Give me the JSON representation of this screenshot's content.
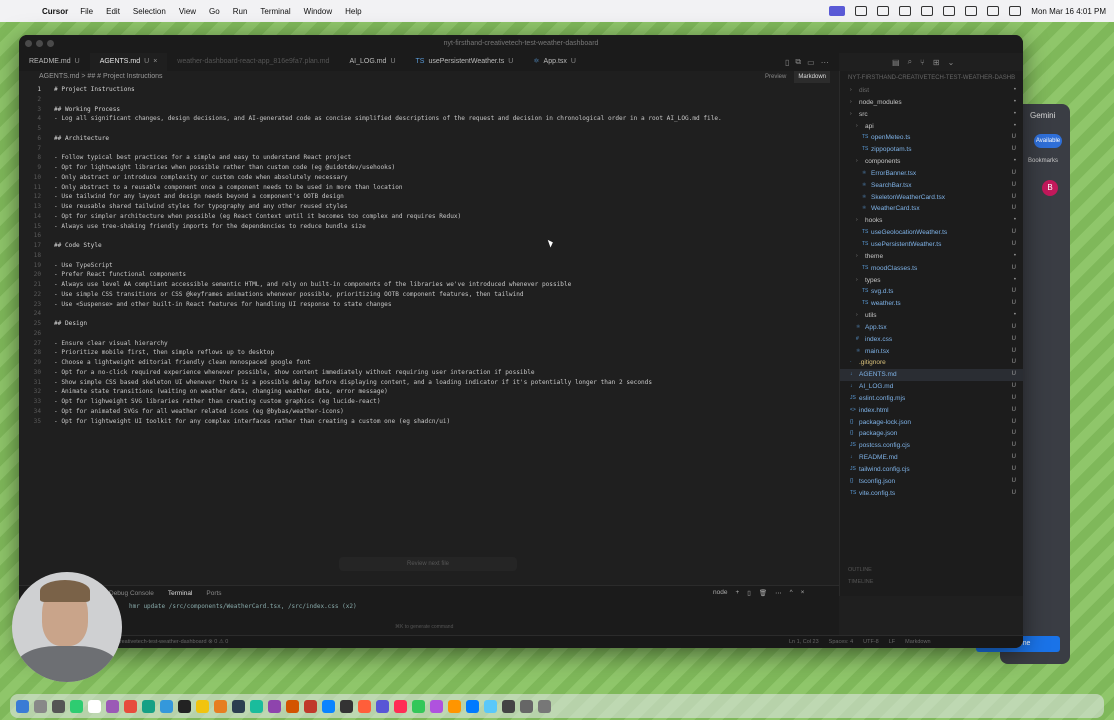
{
  "menubar": {
    "app": "Cursor",
    "items": [
      "File",
      "Edit",
      "Selection",
      "View",
      "Go",
      "Run",
      "Terminal",
      "Window",
      "Help"
    ],
    "clock": "Mon Mar 16  4:01 PM"
  },
  "window": {
    "title": "nyt-firsthand-creativetech-test-weather-dashboard"
  },
  "tabs": [
    {
      "label": "README.md",
      "status": "U",
      "active": false,
      "dim": false
    },
    {
      "label": "AGENTS.md",
      "status": "U",
      "active": true,
      "dim": false,
      "close": "×"
    },
    {
      "label": "weather-dashboard-react-app_816e9fa7.plan.md",
      "status": "",
      "active": false,
      "dim": true
    },
    {
      "label": "AI_LOG.md",
      "status": "U",
      "active": false,
      "dim": false
    },
    {
      "label": "usePersistentWeather.ts",
      "status": "U",
      "active": false,
      "dim": false,
      "icon": "TS"
    },
    {
      "label": "App.tsx",
      "status": "U",
      "active": false,
      "dim": false,
      "icon": "⚛"
    }
  ],
  "breadcrumb": "AGENTS.md > ## # Project Instructions",
  "view_toggle": {
    "preview": "Preview",
    "markdown": "Markdown"
  },
  "editor_lines": [
    {
      "n": "1",
      "t": "# Project Instructions"
    },
    {
      "n": "2",
      "t": ""
    },
    {
      "n": "3",
      "t": "## Working Process"
    },
    {
      "n": "4",
      "t": "- Log all significant changes, design decisions, and AI-generated code as concise simplified descriptions of the request and decision in chronological order in a root AI_LOG.md file."
    },
    {
      "n": "5",
      "t": ""
    },
    {
      "n": "6",
      "t": "## Architecture"
    },
    {
      "n": "7",
      "t": ""
    },
    {
      "n": "8",
      "t": "- Follow typical best practices for a simple and easy to understand React project"
    },
    {
      "n": "9",
      "t": "- Opt for lightweight libraries when possible rather than custom code (eg @uidotdev/usehooks)"
    },
    {
      "n": "10",
      "t": "- Only abstract or introduce complexity or custom code when absolutely necessary"
    },
    {
      "n": "11",
      "t": "- Only abstract to a reusable component once a component needs to be used in more than location"
    },
    {
      "n": "12",
      "t": "- Use tailwind for any layout and design needs beyond a component's OOTB design"
    },
    {
      "n": "13",
      "t": "- Use reusable shared tailwind styles for typography and any other reused styles"
    },
    {
      "n": "14",
      "t": "- Opt for simpler architecture when possible (eg React Context until it becomes too complex and requires Redux)"
    },
    {
      "n": "15",
      "t": "- Always use tree-shaking friendly imports for the dependencies to reduce bundle size"
    },
    {
      "n": "16",
      "t": ""
    },
    {
      "n": "17",
      "t": "## Code Style"
    },
    {
      "n": "18",
      "t": ""
    },
    {
      "n": "19",
      "t": "- Use TypeScript"
    },
    {
      "n": "20",
      "t": "- Prefer React functional components"
    },
    {
      "n": "21",
      "t": "- Always use level AA compliant accessible semantic HTML, and rely on built-in components of the libraries we've introduced whenever possible"
    },
    {
      "n": "22",
      "t": "- Use simple CSS transitions or CSS @keyframes animations whenever possible, prioritizing OOTB component features, then tailwind"
    },
    {
      "n": "23",
      "t": "- Use <Suspense> and other built-in React features for handling UI response to state changes"
    },
    {
      "n": "24",
      "t": ""
    },
    {
      "n": "25",
      "t": "## Design"
    },
    {
      "n": "26",
      "t": ""
    },
    {
      "n": "27",
      "t": "- Ensure clear visual hierarchy"
    },
    {
      "n": "28",
      "t": "- Prioritize mobile first, then simple reflows up to desktop"
    },
    {
      "n": "29",
      "t": "- Choose a lightweight editorial friendly clean monospaced google font"
    },
    {
      "n": "30",
      "t": "- Opt for a no-click required experience whenever possible, show content immediately without requiring user interaction if possible"
    },
    {
      "n": "31",
      "t": "- Show simple CSS based skeleton UI whenever there is a possible delay before displaying content, and a loading indicator if it's potentially longer than 2 seconds"
    },
    {
      "n": "32",
      "t": "- Animate state transitions (waiting on weather data, changing weather data, error message)"
    },
    {
      "n": "33",
      "t": "- Opt for lighweight SVG libraries rather than creating custom graphics (eg lucide-react)"
    },
    {
      "n": "34",
      "t": "- Opt for animated SVGs for all weather related icons (eg @bybas/weather-icons)"
    },
    {
      "n": "35",
      "t": "- Opt for lightweight UI toolkit for any complex interfaces rather than creating a custom one (eg shadcn/ui)"
    }
  ],
  "review_button": "Review next file",
  "explorer": {
    "root": "NYT-FIRSTHAND-CREATIVETECH-TEST-WEATHER-DASHB",
    "rows": [
      {
        "name": "dist",
        "indent": 1,
        "kind": "folder",
        "color": "dimmed",
        "status": "•"
      },
      {
        "name": "node_modules",
        "indent": 1,
        "kind": "folder",
        "color": "folder",
        "status": "•"
      },
      {
        "name": "src",
        "indent": 1,
        "kind": "folder",
        "color": "folder",
        "status": "•"
      },
      {
        "name": "api",
        "indent": 2,
        "kind": "folder",
        "color": "folder",
        "status": "•"
      },
      {
        "name": "openMeteo.ts",
        "indent": 3,
        "kind": "ts",
        "color": "new",
        "status": "U"
      },
      {
        "name": "zippopotam.ts",
        "indent": 3,
        "kind": "ts",
        "color": "new",
        "status": "U"
      },
      {
        "name": "components",
        "indent": 2,
        "kind": "folder",
        "color": "folder",
        "status": "•"
      },
      {
        "name": "ErrorBanner.tsx",
        "indent": 3,
        "kind": "tsx",
        "color": "new",
        "status": "U"
      },
      {
        "name": "SearchBar.tsx",
        "indent": 3,
        "kind": "tsx",
        "color": "new",
        "status": "U"
      },
      {
        "name": "SkeletonWeatherCard.tsx",
        "indent": 3,
        "kind": "tsx",
        "color": "new",
        "status": "U"
      },
      {
        "name": "WeatherCard.tsx",
        "indent": 3,
        "kind": "tsx",
        "color": "new",
        "status": "U"
      },
      {
        "name": "hooks",
        "indent": 2,
        "kind": "folder",
        "color": "folder",
        "status": "•"
      },
      {
        "name": "useGeolocationWeather.ts",
        "indent": 3,
        "kind": "ts",
        "color": "new",
        "status": "U"
      },
      {
        "name": "usePersistentWeather.ts",
        "indent": 3,
        "kind": "ts",
        "color": "new",
        "status": "U"
      },
      {
        "name": "theme",
        "indent": 2,
        "kind": "folder",
        "color": "folder",
        "status": "•"
      },
      {
        "name": "moodClasses.ts",
        "indent": 3,
        "kind": "ts",
        "color": "new",
        "status": "U"
      },
      {
        "name": "types",
        "indent": 2,
        "kind": "folder",
        "color": "folder",
        "status": "•"
      },
      {
        "name": "svg.d.ts",
        "indent": 3,
        "kind": "ts",
        "color": "new",
        "status": "U"
      },
      {
        "name": "weather.ts",
        "indent": 3,
        "kind": "ts",
        "color": "new",
        "status": "U"
      },
      {
        "name": "utils",
        "indent": 2,
        "kind": "folder",
        "color": "folder",
        "status": "•"
      },
      {
        "name": "App.tsx",
        "indent": 2,
        "kind": "tsx",
        "color": "new",
        "status": "U"
      },
      {
        "name": "index.css",
        "indent": 2,
        "kind": "css",
        "color": "new",
        "status": "U"
      },
      {
        "name": "main.tsx",
        "indent": 2,
        "kind": "tsx",
        "color": "new",
        "status": "U"
      },
      {
        "name": ".gitignore",
        "indent": 1,
        "kind": "file",
        "color": "mod",
        "status": "U"
      },
      {
        "name": "AGENTS.md",
        "indent": 1,
        "kind": "md",
        "color": "new",
        "status": "U",
        "active": true
      },
      {
        "name": "AI_LOG.md",
        "indent": 1,
        "kind": "md",
        "color": "new",
        "status": "U"
      },
      {
        "name": "eslint.config.mjs",
        "indent": 1,
        "kind": "js",
        "color": "new",
        "status": "U"
      },
      {
        "name": "index.html",
        "indent": 1,
        "kind": "html",
        "color": "new",
        "status": "U"
      },
      {
        "name": "package-lock.json",
        "indent": 1,
        "kind": "json",
        "color": "new",
        "status": "U"
      },
      {
        "name": "package.json",
        "indent": 1,
        "kind": "json",
        "color": "new",
        "status": "U"
      },
      {
        "name": "postcss.config.cjs",
        "indent": 1,
        "kind": "js",
        "color": "new",
        "status": "U"
      },
      {
        "name": "README.md",
        "indent": 1,
        "kind": "md",
        "color": "new",
        "status": "U"
      },
      {
        "name": "tailwind.config.cjs",
        "indent": 1,
        "kind": "js",
        "color": "new",
        "status": "U"
      },
      {
        "name": "tsconfig.json",
        "indent": 1,
        "kind": "json",
        "color": "new",
        "status": "U"
      },
      {
        "name": "vite.config.ts",
        "indent": 1,
        "kind": "ts",
        "color": "new",
        "status": "U"
      }
    ],
    "outline": "OUTLINE",
    "timeline": "TIMELINE"
  },
  "terminal": {
    "tabs": [
      "Debug Console",
      "Terminal",
      "Ports"
    ],
    "active_tab": "Terminal",
    "shell": "node",
    "output": "hmr update /src/components/WeatherCard.tsx, /src/index.css (x2)",
    "hint": "⌘K to generate command"
  },
  "statusbar": {
    "left": "creativetech-test-weather-dashboard  ⊗ 0 ⚠ 0",
    "items": [
      "Ln 1, Col 23",
      "Spaces: 4",
      "UTF-8",
      "LF",
      "Markdown"
    ]
  },
  "browser": {
    "panel_title": "Gemini",
    "available": "Available",
    "bookmarks": "Bookmarks",
    "avatar_letter": "B",
    "chrome_button": "Chrome"
  },
  "colors": {
    "accent": "#5a9bd8",
    "untracked": "#7fb3e8",
    "modified": "#d9c07a"
  }
}
